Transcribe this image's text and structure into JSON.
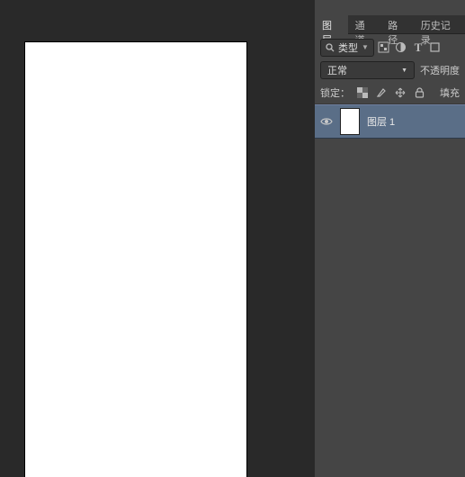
{
  "tabs": {
    "layers": "图层",
    "channels": "通道",
    "paths": "路径",
    "history": "历史记录"
  },
  "filter": {
    "kind_label": "类型",
    "icons": [
      "image-layers-icon",
      "adjustment-layers-icon",
      "text-layers-icon",
      "shape-layers-icon",
      "smart-layers-icon"
    ]
  },
  "blend": {
    "mode": "正常",
    "opacity_label": "不透明度"
  },
  "lock": {
    "label": "锁定：",
    "fill_label": "填充"
  },
  "layers": [
    {
      "name": "图层 1",
      "visible": true
    }
  ]
}
